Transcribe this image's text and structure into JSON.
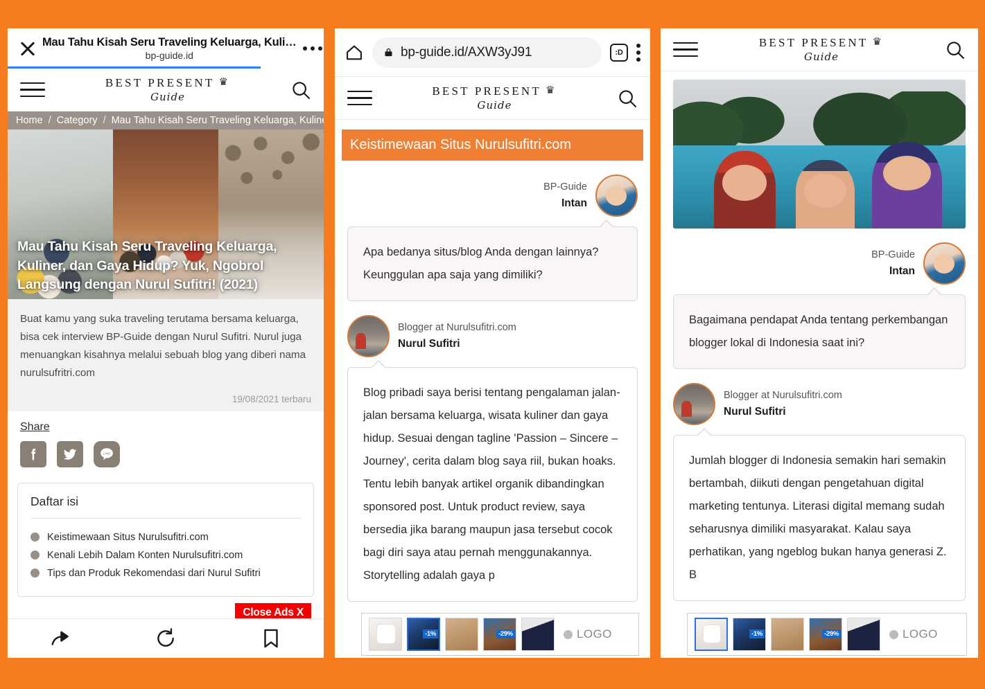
{
  "theme": {
    "background": "#F57C1F",
    "accent": "#ef8033",
    "breadcrumb_bg": "#9a918a",
    "ads_red": "#f40000"
  },
  "brand": {
    "line1": "BEST PRESENT",
    "mark": "♛",
    "line2": "Guide"
  },
  "panel1": {
    "tab": {
      "title": "Mau Tahu Kisah Seru Traveling Keluarga, Kuli…",
      "host": "bp-guide.id",
      "close_icon": "close-icon",
      "menu_icon": "more-horizontal-icon"
    },
    "breadcrumb": [
      "Home",
      "Category",
      "Mau Tahu Kisah Seru Traveling Keluarga, Kuline"
    ],
    "hero_title": "Mau Tahu Kisah Seru Traveling Keluarga, Kuliner, dan Gaya Hidup? Yuk, Ngobrol Langsung dengan Nurul Sufitri! (2021)",
    "excerpt": "Buat kamu yang suka traveling terutama bersama keluarga, bisa cek interview BP-Guide dengan Nurul Sufitri. Nurul juga menuangkan kisahnya melalui sebuah blog yang diberi nama nurulsufritri.com",
    "date": "19/08/2021 terbaru",
    "share_label": "Share",
    "share_items": [
      "facebook-icon",
      "twitter-icon",
      "line-icon"
    ],
    "toc_title": "Daftar isi",
    "toc_items": [
      "Keistimewaan Situs Nurulsufitri.com",
      "Kenali Lebih Dalam Konten Nurulsufitri.com",
      "Tips dan Produk Rekomendasi dari Nurul Sufitri"
    ],
    "close_ads": "Close Ads X",
    "bottom_nav": [
      "share-icon",
      "reload-icon",
      "bookmark-icon"
    ]
  },
  "panel2": {
    "omnibox": {
      "home_icon": "home-icon",
      "lock_icon": "lock-icon",
      "url": "bp-guide.id/AXW3yJ91",
      "emoji_icon": ":D",
      "menu_icon": "kebab-menu-icon"
    },
    "section_heading": "Keistimewaan Situs Nurulsufitri.com",
    "question": {
      "role": "BP-Guide",
      "name": "Intan",
      "text": "Apa bedanya situs/blog Anda dengan lainnya? Keunggulan apa saja yang dimiliki?"
    },
    "answer": {
      "role": "Blogger at Nurulsufitri.com",
      "name": "Nurul Sufitri",
      "text": "Blog pribadi saya berisi tentang pengalaman jalan-jalan bersama keluarga, wisata kuliner dan gaya hidup. Sesuai dengan tagline 'Passion – Sincere –Journey', cerita dalam blog saya riil, bukan hoaks. Tentu lebih banyak artikel organik dibandingkan sponsored post. Untuk product review, saya bersedia jika barang maupun jasa tersebut cocok bagi diri saya atau pernah menggunakannya. Storytelling adalah gaya p"
    },
    "ads": {
      "badges": [
        "",
        "-1%",
        "",
        "-29%",
        ""
      ],
      "logo": "LOGO"
    }
  },
  "panel3": {
    "header_icons": {
      "menu": "hamburger-icon",
      "search": "search-icon"
    },
    "article_image_alt": "three-people-swimming-pool-photo",
    "question": {
      "role": "BP-Guide",
      "name": "Intan",
      "text": "Bagaimana pendapat Anda tentang perkembangan blogger lokal di Indonesia saat ini?"
    },
    "answer": {
      "role": "Blogger at Nurulsufitri.com",
      "name": "Nurul Sufitri",
      "text": "Jumlah blogger di Indonesia semakin hari semakin bertambah, diikuti dengan pengetahuan digital marketing tentunya. Literasi digital memang sudah seharusnya dimiliki masyarakat. Kalau saya perhatikan, yang ngeblog bukan hanya generasi Z. B"
    },
    "ads": {
      "badges": [
        "",
        "-1%",
        "",
        "-29%",
        ""
      ],
      "logo": "LOGO"
    }
  }
}
